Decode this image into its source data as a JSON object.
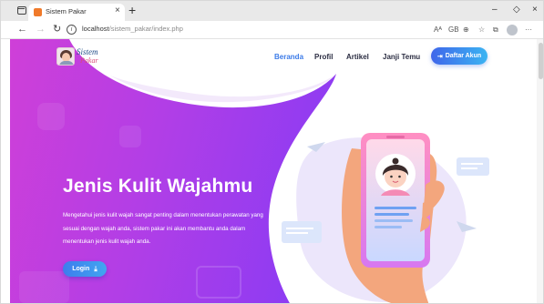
{
  "browser": {
    "tab_title": "Sistem Pakar",
    "tab_close_glyph": "×",
    "new_tab_glyph": "+",
    "url_host": "localhost",
    "url_path": "/sistem_pakar/index.php",
    "info_glyph": "i",
    "read_aloud_glyph": "Aᴬ",
    "font_size_glyph": "GB",
    "window_minimize": "–",
    "window_maximize": "◇",
    "window_close": "×"
  },
  "navbar": {
    "logo_line1": "Sistem",
    "logo_line2": "Pakar",
    "items": [
      {
        "label": "Beranda"
      },
      {
        "label": "Profil"
      },
      {
        "label": "Artikel"
      },
      {
        "label": "Janji Temu"
      }
    ],
    "signup_icon": "⇥",
    "signup_label": "Daftar Akun"
  },
  "hero": {
    "title": "Jenis Kulit Wajahmu",
    "description": "Mengetahui jenis kulit wajah sangat penting dalam menentukan perawatan yang sesuai dengan wajah anda, sistem pakar ini akan membantu anda dalam menentukan jenis kulit wajah anda.",
    "login_label": "Login",
    "login_icon": "⤓"
  },
  "colors": {
    "hero_gradient_start": "#c33cdc",
    "hero_gradient_end": "#9b3cf0",
    "accent_blue": "#3c7be8",
    "nav_text": "#2b2d42"
  }
}
